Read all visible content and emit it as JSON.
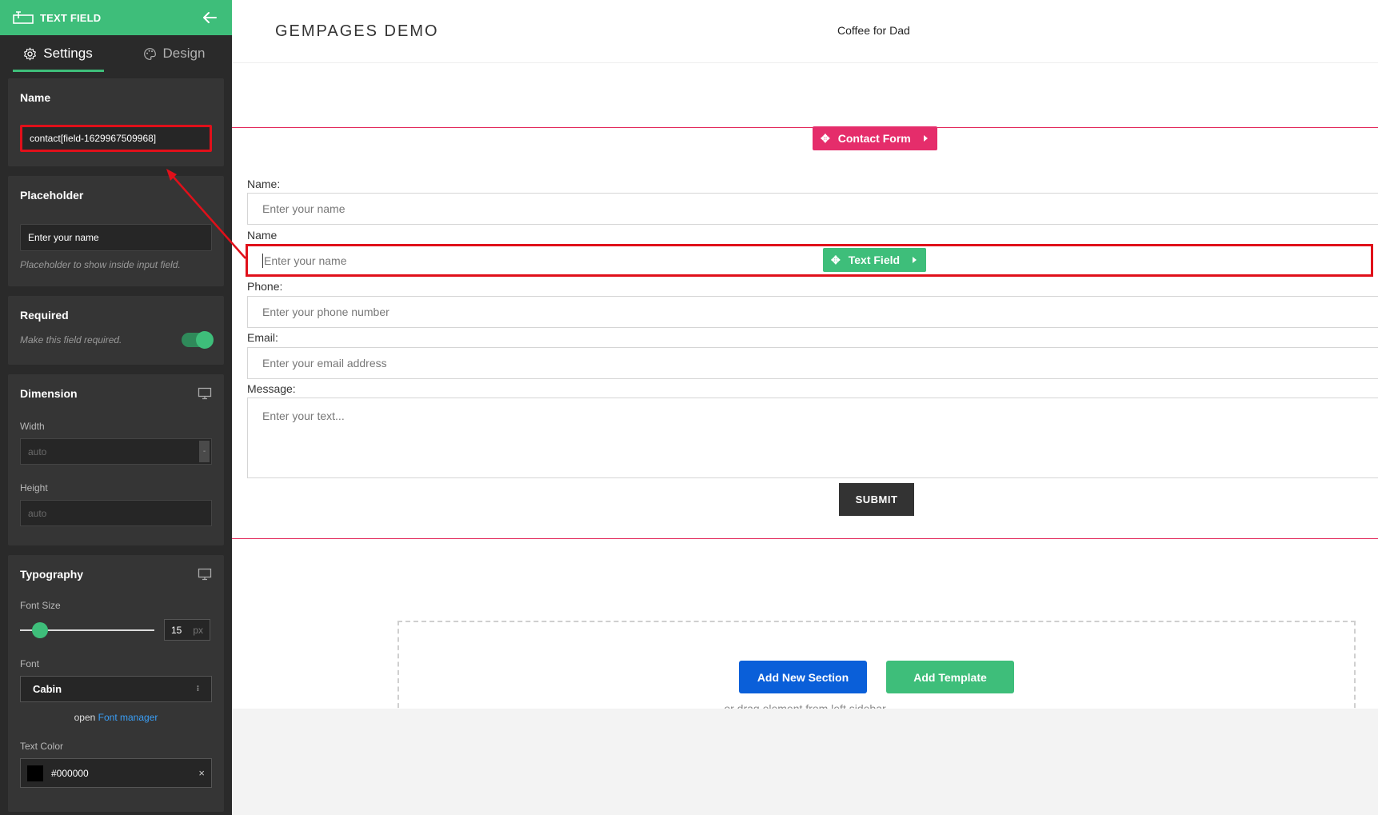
{
  "sidebar": {
    "header_title": "TEXT FIELD",
    "tabs": [
      {
        "label": "Settings"
      },
      {
        "label": "Design"
      }
    ],
    "name_panel": {
      "title": "Name",
      "value": "contact[field-1629967509968]"
    },
    "placeholder_panel": {
      "title": "Placeholder",
      "value": "Enter your name",
      "hint": "Placeholder to show inside input field."
    },
    "required_panel": {
      "title": "Required",
      "hint": "Make this field required.",
      "enabled": true
    },
    "dimension_panel": {
      "title": "Dimension",
      "width_label": "Width",
      "width_placeholder": "auto",
      "width_suffix": "-",
      "height_label": "Height",
      "height_placeholder": "auto"
    },
    "typography_panel": {
      "title": "Typography",
      "font_size_label": "Font Size",
      "font_size_value": "15",
      "font_size_unit": "px",
      "font_label": "Font",
      "font_value": "Cabin",
      "font_manager_prefix": "open",
      "font_manager_link": "Font manager",
      "text_color_label": "Text Color",
      "text_color_value": "#000000",
      "text_color_clear": "×"
    }
  },
  "canvas": {
    "brand": "GEMPAGES DEMO",
    "nav_item": "Coffee for Dad",
    "contact_form_tag": "Contact Form",
    "text_field_tag": "Text Field",
    "fields": [
      {
        "label": "Name:",
        "placeholder": "Enter your name"
      },
      {
        "label": "Name",
        "placeholder": "Enter your name"
      },
      {
        "label": "Phone:",
        "placeholder": "Enter your phone number"
      },
      {
        "label": "Email:",
        "placeholder": "Enter your email address"
      },
      {
        "label": "Message:",
        "placeholder": "Enter your text..."
      }
    ],
    "submit_label": "SUBMIT",
    "add_section_label": "Add New Section",
    "add_template_label": "Add Template",
    "drag_hint": "or drag element from left sidebar"
  },
  "colors": {
    "accent_green": "#3ebe7a",
    "pink": "#e52d6b",
    "blue": "#0a5fd9",
    "highlight_red": "#e0101a",
    "sidebar_bg": "#2a2a2a"
  }
}
